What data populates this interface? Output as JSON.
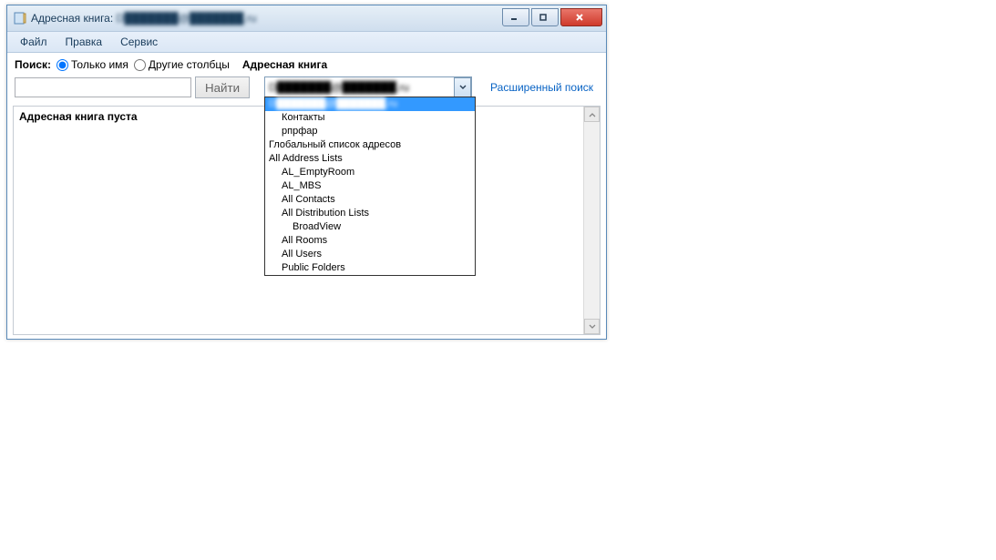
{
  "window": {
    "title_prefix": "Адресная книга: ",
    "title_email": "D███████@███████.ru"
  },
  "menu": {
    "file": "Файл",
    "edit": "Правка",
    "tools": "Сервис"
  },
  "search": {
    "label": "Поиск:",
    "name_only": "Только имя",
    "other_cols": "Другие столбцы",
    "address_book": "Адресная книга",
    "find_btn": "Найти",
    "advanced_link": "Расширенный поиск",
    "combo_value": "D███████@███████.ru"
  },
  "dropdown": {
    "sel": "D███████@███████.ru",
    "contacts": "Контакты",
    "rprfar": "рпрфар",
    "gal": "Глобальный список адресов",
    "all_lists": "All Address Lists",
    "al_empty": "AL_EmptyRoom",
    "al_mbs": "AL_MBS",
    "all_contacts": "All Contacts",
    "all_dist": "All Distribution Lists",
    "broadview": "BroadView",
    "all_rooms": "All Rooms",
    "all_users": "All Users",
    "pub_folders": "Public Folders"
  },
  "content": {
    "empty": "Адресная книга пуста"
  }
}
